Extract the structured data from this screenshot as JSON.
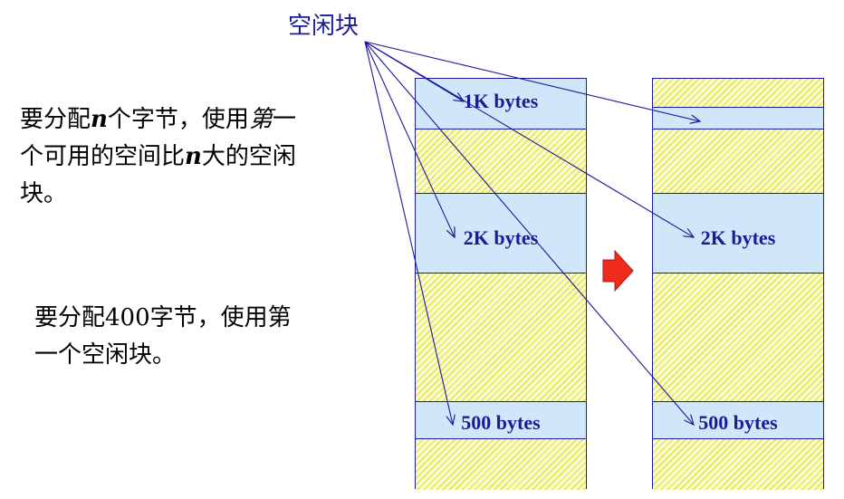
{
  "title": "空闲块",
  "text_1": {
    "line1_pre": "要分配",
    "line1_var": "n",
    "line1_mid": "个字节，使用",
    "line1_it": "第",
    "line1_post": "一",
    "line2_pre": "个可用的空间比",
    "line2_var": "n",
    "line2_post": "大的空闲",
    "line3": "块。"
  },
  "text_2": {
    "line1": "要分配400字节，使用第",
    "line2": "一个空闲块。"
  },
  "left_column": {
    "block_1": "1K bytes",
    "block_3": "2K bytes",
    "block_5": "500 bytes"
  },
  "right_column": {
    "block_4": "2K bytes",
    "block_6": "500 bytes"
  },
  "colors": {
    "free_block": "#cfe7f8",
    "used_block_hatch": "#e6e65a",
    "border_and_text": "#1a1a9a",
    "transition_arrow": "#ee2b1c"
  },
  "icons": [
    "transition-arrow-icon"
  ]
}
